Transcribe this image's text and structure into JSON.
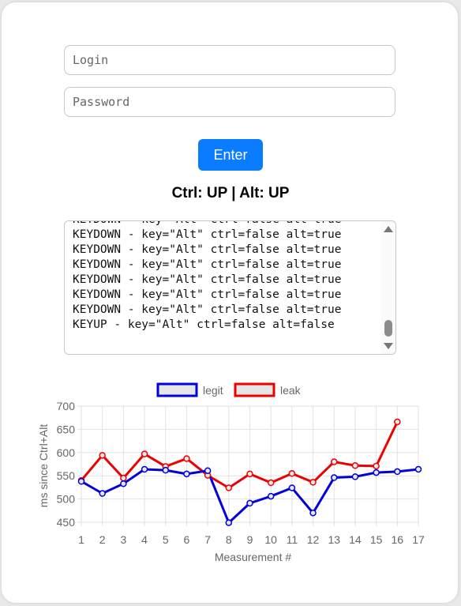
{
  "login": {
    "placeholder": "Login"
  },
  "password": {
    "placeholder": "Password"
  },
  "enter_button": {
    "label": "Enter"
  },
  "status": {
    "text": "Ctrl: UP | Alt: UP"
  },
  "log": {
    "lines": [
      "KEYDOWN - key=\"Alt\" ctrl=false alt=true",
      "KEYDOWN - key=\"Alt\" ctrl=false alt=true",
      "KEYDOWN - key=\"Alt\" ctrl=false alt=true",
      "KEYDOWN - key=\"Alt\" ctrl=false alt=true",
      "KEYDOWN - key=\"Alt\" ctrl=false alt=true",
      "KEYDOWN - key=\"Alt\" ctrl=false alt=true",
      "KEYDOWN - key=\"Alt\" ctrl=false alt=true",
      "KEYUP - key=\"Alt\" ctrl=false alt=false"
    ]
  },
  "colors": {
    "accent": "#0a7cff",
    "legit": "#0000dd",
    "leak": "#ee0000"
  },
  "chart_data": {
    "type": "line",
    "xlabel": "Measurement #",
    "ylabel": "ms since Ctrl+Alt",
    "categories": [
      "1",
      "2",
      "3",
      "4",
      "5",
      "6",
      "7",
      "8",
      "9",
      "10",
      "11",
      "12",
      "13",
      "14",
      "15",
      "16",
      "17"
    ],
    "ylim": [
      450,
      700
    ],
    "yticks": [
      450,
      500,
      550,
      600,
      650,
      700
    ],
    "legend_position": "top",
    "grid": true,
    "series": [
      {
        "name": "legit",
        "color": "#0000dd",
        "values": [
          538,
          512,
          533,
          564,
          562,
          554,
          561,
          449,
          491,
          506,
          524,
          470,
          546,
          548,
          557,
          559,
          564
        ]
      },
      {
        "name": "leak",
        "color": "#ee0000",
        "values": [
          540,
          594,
          545,
          597,
          570,
          587,
          551,
          524,
          554,
          535,
          555,
          536,
          580,
          572,
          571,
          666,
          null
        ]
      }
    ]
  }
}
